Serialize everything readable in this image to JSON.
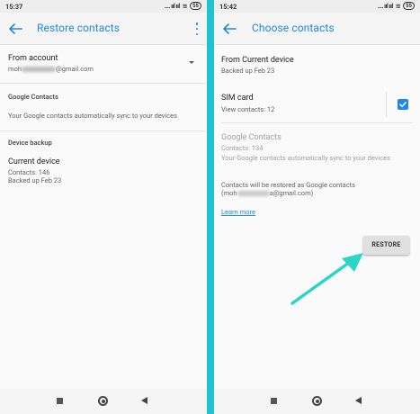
{
  "left": {
    "status": {
      "time": "15:37",
      "signal_text": "....",
      "battery": "55"
    },
    "app_bar": {
      "title": "Restore contacts"
    },
    "account": {
      "label": "From account",
      "email_prefix": "moh",
      "email_suffix": "@gmail.com"
    },
    "google_contacts": {
      "header": "Google Contacts",
      "description": "Your Google contacts automatically sync to your devices"
    },
    "device_backup": {
      "header": "Device backup",
      "device_name": "Current device",
      "contacts": "Contacts: 146",
      "backed_up": "Backed up Feb 23"
    }
  },
  "right": {
    "status": {
      "time": "15:42",
      "signal_text": "....",
      "battery": "55"
    },
    "app_bar": {
      "title": "Choose contacts"
    },
    "source": {
      "title": "From Current device",
      "backed_up": "Backed up Feb 23"
    },
    "sim_card": {
      "title": "SIM card",
      "contacts": "View contacts: 12",
      "checked": true
    },
    "google_contacts": {
      "title": "Google Contacts",
      "contacts": "Contacts: 134",
      "description": "Your Google contacts automatically sync to your devices"
    },
    "restore_note": {
      "line1": "Contacts will be restored as Google contacts",
      "email_prefix": "(moh",
      "email_suffix": "a@gmail.com)"
    },
    "learn_more": "Learn more",
    "restore_button": "RESTORE"
  },
  "colors": {
    "accent": "#1e88e5",
    "divider_bar": "#1fc3cf",
    "arrow": "#2dd4c8"
  },
  "icons": {
    "back": "arrow-left-icon",
    "menu": "more-vert-icon",
    "dropdown": "caret-down-icon",
    "check": "checkbox-checked-icon",
    "nav_recents": "square-icon",
    "nav_home": "circle-icon",
    "nav_back": "triangle-back-icon",
    "annotation": "arrow-pointer-icon"
  }
}
